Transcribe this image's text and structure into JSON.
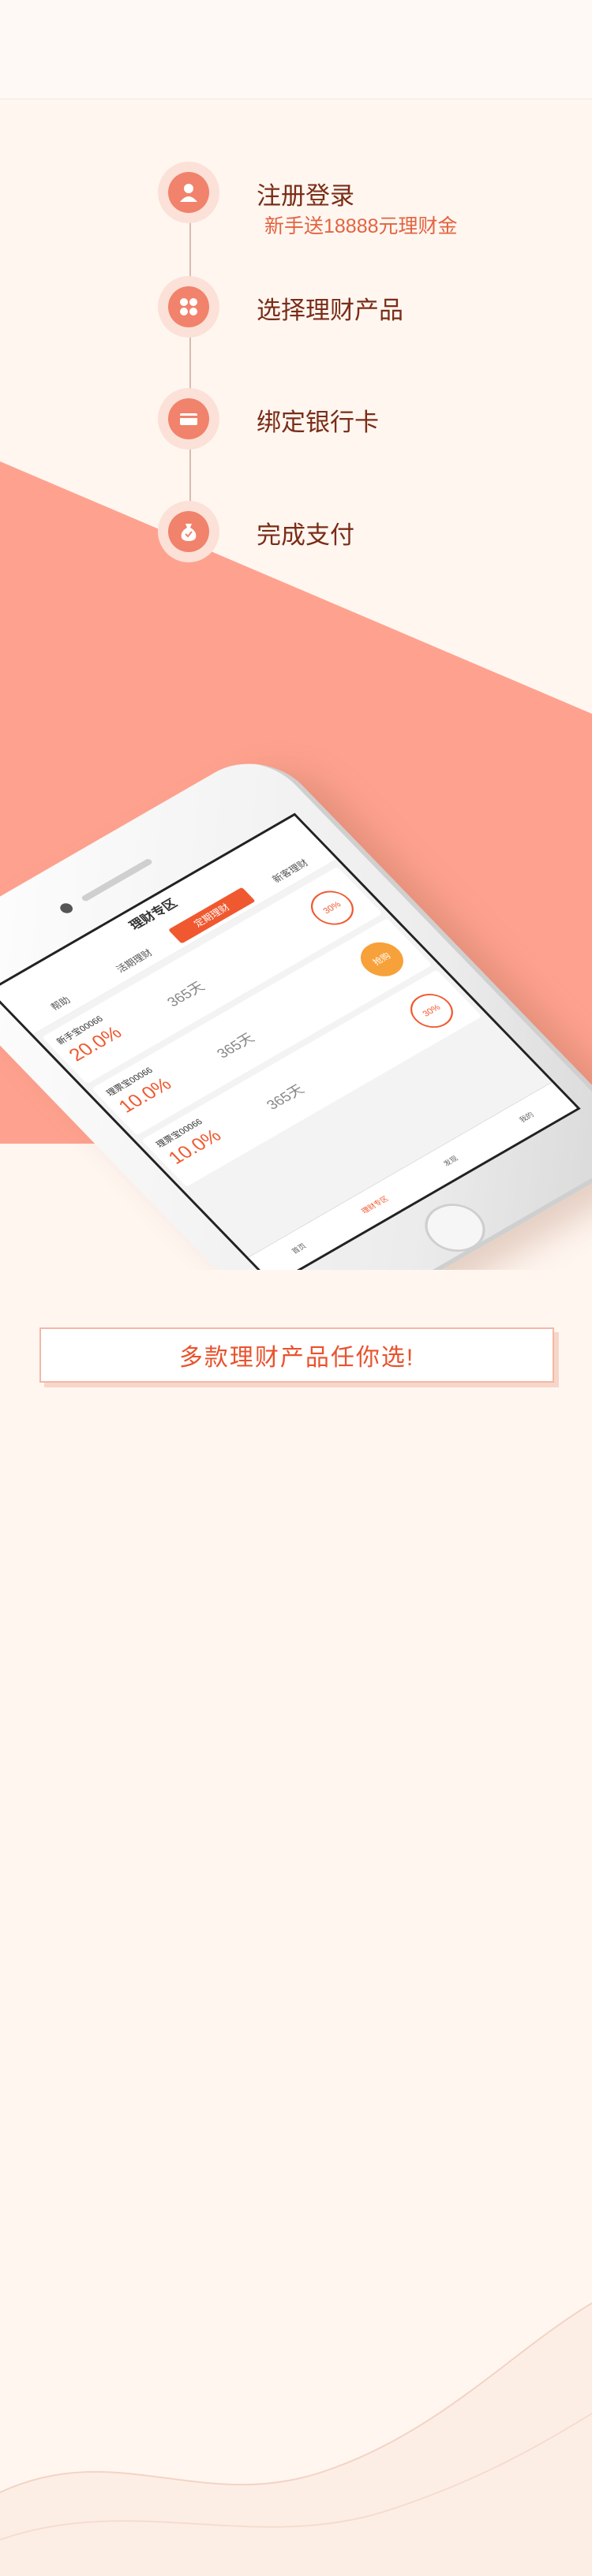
{
  "steps": [
    {
      "title": "注册登录",
      "subtitle": "新手送18888元理财金",
      "icon": "user-icon"
    },
    {
      "title": "选择理财产品",
      "icon": "grid-icon"
    },
    {
      "title": "绑定银行卡",
      "icon": "bank-card-icon"
    },
    {
      "title": "完成支付",
      "icon": "money-bag-icon"
    }
  ],
  "phone": {
    "header_title": "理财专区",
    "tabs": [
      "帮助",
      "活期理财",
      "定期理财",
      "新客理财"
    ],
    "products": [
      {
        "name": "新手宝00066",
        "rate": "20.0%",
        "days": "365天",
        "ring": "30%"
      },
      {
        "name": "理票宝00066",
        "rate": "10.0%",
        "days": "365天",
        "ring": "抢购"
      },
      {
        "name": "理票宝00066",
        "rate": "10.0%",
        "days": "365天",
        "ring": "30%"
      }
    ],
    "footer_tabs": [
      "首页",
      "理财专区",
      "发现",
      "我的"
    ]
  },
  "banner": {
    "text": "多款理财产品任你选!"
  },
  "colors": {
    "accent": "#f0582f",
    "wedge": "#fea28f",
    "background": "#fff6f0"
  }
}
